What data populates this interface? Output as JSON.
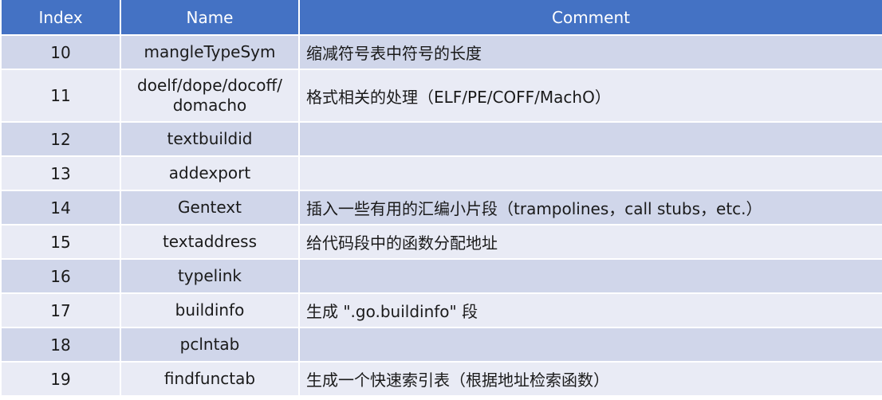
{
  "header": {
    "index": "Index",
    "name": "Name",
    "comment": "Comment"
  },
  "rows": [
    {
      "index": "10",
      "name": "mangleTypeSym",
      "comment": "缩减符号表中符号的长度"
    },
    {
      "index": "11",
      "name": "doelf/dope/docoff/\ndomacho",
      "comment": "格式相关的处理（ELF/PE/COFF/MachO）"
    },
    {
      "index": "12",
      "name": "textbuildid",
      "comment": ""
    },
    {
      "index": "13",
      "name": "addexport",
      "comment": ""
    },
    {
      "index": "14",
      "name": "Gentext",
      "comment": "插入一些有用的汇编小片段（trampolines，call stubs，etc.）"
    },
    {
      "index": "15",
      "name": "textaddress",
      "comment": "给代码段中的函数分配地址"
    },
    {
      "index": "16",
      "name": "typelink",
      "comment": ""
    },
    {
      "index": "17",
      "name": "buildinfo",
      "comment": "生成 \".go.buildinfo\" 段"
    },
    {
      "index": "18",
      "name": "pclntab",
      "comment": ""
    },
    {
      "index": "19",
      "name": "findfunctab",
      "comment": "生成一个快速索引表（根据地址检索函数）"
    }
  ]
}
